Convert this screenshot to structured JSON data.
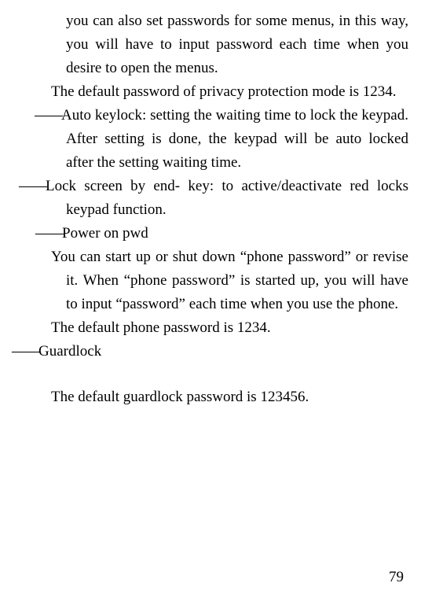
{
  "body": {
    "intro_cont": "you can also set passwords for some menus, in this way, you will have to input password each time when you desire to open the menus.",
    "privacy_default": "The default password of privacy protection mode is 1234.",
    "auto_keylock": "Auto keylock: setting the waiting time to lock the keypad. After setting is done, the keypad will be auto locked after the setting waiting time.",
    "lock_screen": "Lock screen by end- key: to active/deactivate red locks keypad function.",
    "power_on_pwd_title": "Power on pwd",
    "power_on_pwd_body": "You can start up or shut down “phone password” or revise it. When “phone password” is started up, you will have to input “password” each time when you use the phone.",
    "phone_default": "The default phone password is 1234.",
    "guardlock_title": "Guardlock",
    "guardlock_default": "The default guardlock password is 123456."
  },
  "dashes": {
    "double_heavy": "——",
    "double_thin": "——"
  },
  "page_number": "79"
}
